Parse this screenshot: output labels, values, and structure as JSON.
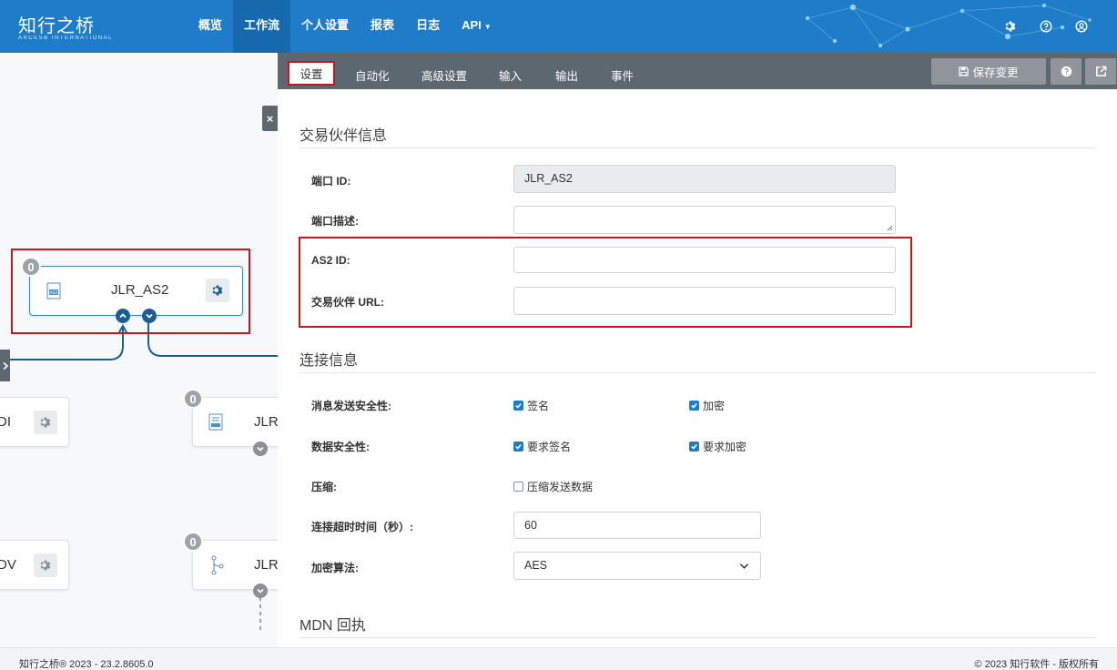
{
  "header": {
    "logo_text": "知行之桥",
    "logo_subtext": "ARCESB INTERNATIONAL",
    "nav": [
      {
        "label": "概览"
      },
      {
        "label": "工作流"
      },
      {
        "label": "个人设置"
      },
      {
        "label": "报表"
      },
      {
        "label": "日志"
      },
      {
        "label": "API"
      }
    ],
    "icons": [
      "gear-icon",
      "help-icon",
      "user-icon"
    ]
  },
  "canvas": {
    "close_label": "×",
    "nodes": [
      {
        "label": "JLR_AS2",
        "badge": "0"
      },
      {
        "label": "DI"
      },
      {
        "label": "JLR_",
        "badge": "0"
      },
      {
        "label": "DV"
      },
      {
        "label": "JLR_",
        "badge": "0"
      }
    ]
  },
  "panel": {
    "tabs": [
      {
        "label": "设置"
      },
      {
        "label": "自动化"
      },
      {
        "label": "高级设置"
      },
      {
        "label": "输入"
      },
      {
        "label": "输出"
      },
      {
        "label": "事件"
      }
    ],
    "save_label": "保存变更",
    "sections": {
      "partner": "交易伙伴信息",
      "connection": "连接信息",
      "mdn": "MDN 回执"
    },
    "fields": {
      "port_id_label": "端口 ID:",
      "port_id_value": "JLR_AS2",
      "port_desc_label": "端口描述:",
      "port_desc_value": "",
      "as2_id_label": "AS2 ID:",
      "as2_id_value": "",
      "partner_url_label": "交易伙伴 URL:",
      "partner_url_value": "",
      "msg_security_label": "消息发送安全性:",
      "sign_label": "签名",
      "sign_checked": true,
      "encrypt_label": "加密",
      "encrypt_checked": true,
      "data_security_label": "数据安全性:",
      "require_sign_label": "要求签名",
      "require_sign_checked": true,
      "require_encrypt_label": "要求加密",
      "require_encrypt_checked": true,
      "compress_label": "压缩:",
      "compress_send_label": "压缩发送数据",
      "compress_send_checked": false,
      "timeout_label": "连接超时时间（秒）:",
      "timeout_value": "60",
      "algo_label": "加密算法:",
      "algo_value": "AES"
    }
  },
  "footer": {
    "left": "知行之桥® 2023 - 23.2.8605.0",
    "right": "© 2023 知行软件 - 版权所有"
  },
  "colors": {
    "brand": "#1e7cc8",
    "tabbar": "#5d6770",
    "highlight": "#c8161d"
  }
}
